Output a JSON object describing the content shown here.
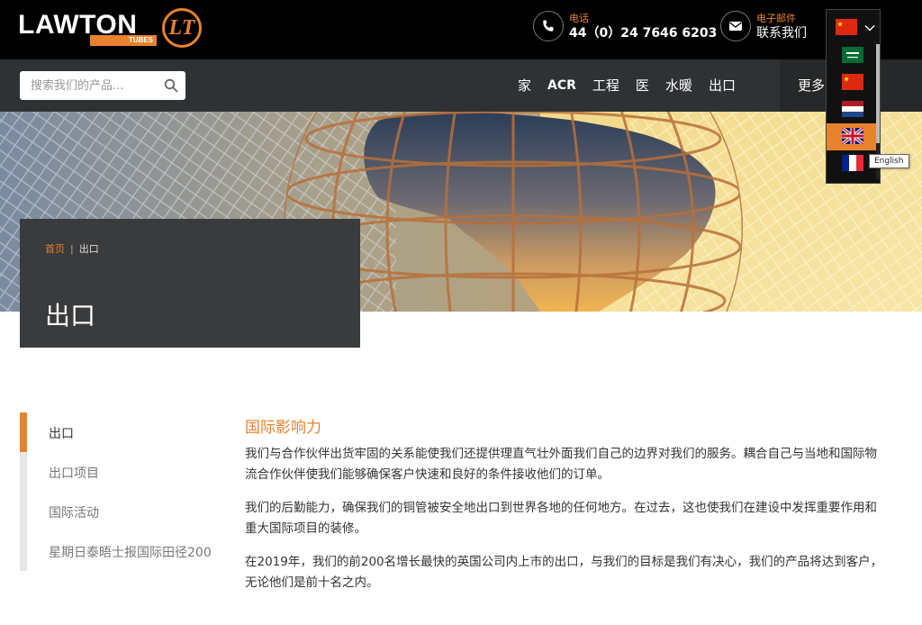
{
  "brand": {
    "name": "LAWTON",
    "tagline": "TUBES",
    "mark": "LT",
    "accent": "#e8822e"
  },
  "header": {
    "phone_label": "电话",
    "phone_value": "44（0）24 7646 6203",
    "email_label": "电子邮件",
    "email_value": "联系我们"
  },
  "language": {
    "current": "cn-flag",
    "options": [
      "sa-flag",
      "cn-flag",
      "nl-flag",
      "gb-flag",
      "fr-flag"
    ],
    "highlighted": "gb-flag",
    "tooltip": "English"
  },
  "search": {
    "placeholder": "搜索我们的产品..."
  },
  "nav": {
    "items": [
      "家",
      "ACR",
      "工程",
      "医",
      "水暖",
      "出口"
    ],
    "more": "更多"
  },
  "hero": {
    "breadcrumb_home": "首页",
    "breadcrumb_sep": "|",
    "breadcrumb_current": "出口",
    "title": "出口"
  },
  "sidebar": {
    "items": [
      {
        "label": "出口",
        "active": true
      },
      {
        "label": "出口项目",
        "active": false
      },
      {
        "label": "国际活动",
        "active": false
      },
      {
        "label": "星期日泰晤士报国际田径200",
        "active": false
      }
    ]
  },
  "content": {
    "heading": "国际影响力",
    "paragraphs": [
      "我们与合作伙伴出货牢固的关系能使我们还提供理直气壮外面我们自己的边界对我们的服务。耦合自己与当地和国际物流合作伙伴使我们能够确保客户快速和良好的条件接收他们的订单。",
      "我们的后勤能力，确保我们的铜管被安全地出口到世界各地的任何地方。在过去，这也使我们在建设中发挥重要作用和重大国际项目的装修。",
      "在2019年，我们的前200名增长最快的英国公司内上市的出口，与我们的目标是我们有决心，我们的产品将达到客户，无论他们是前十名之内。"
    ]
  }
}
